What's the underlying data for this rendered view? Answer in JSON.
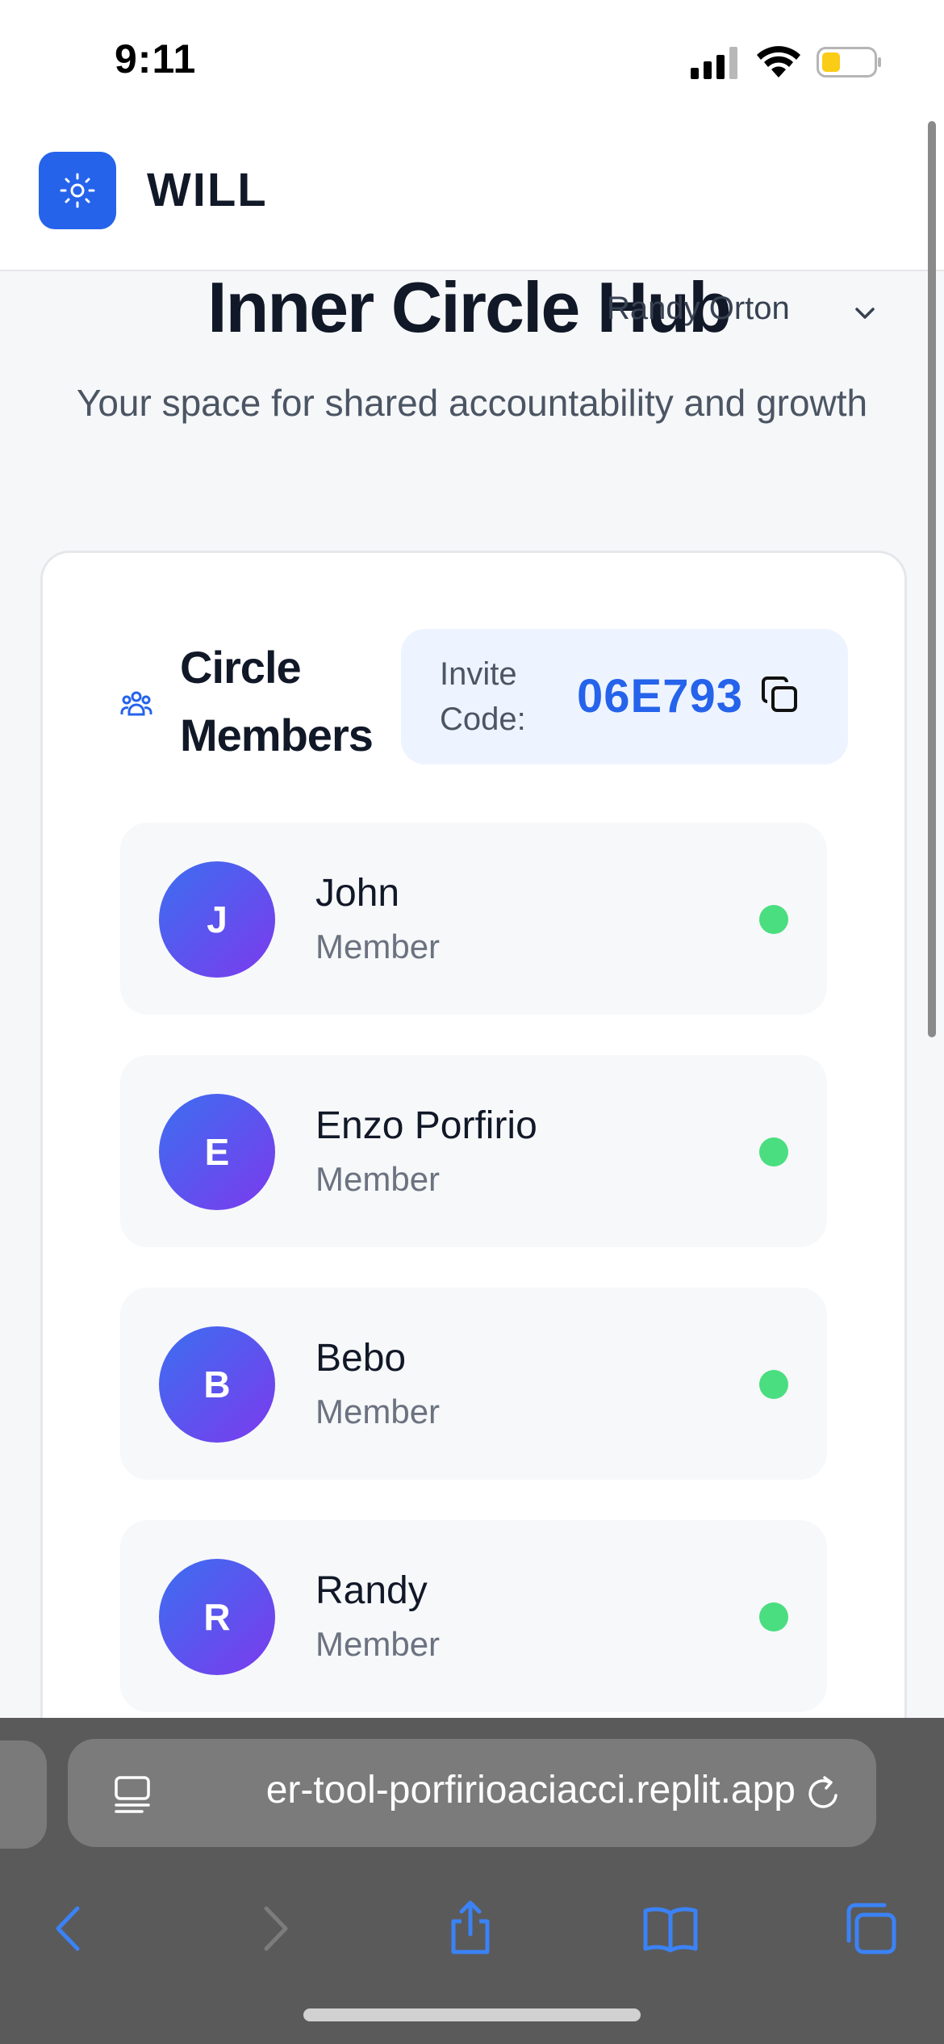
{
  "status_bar": {
    "time": "9:11",
    "icons": [
      "signal-icon",
      "wifi-icon",
      "battery-icon"
    ]
  },
  "header": {
    "app_name": "WILL",
    "logo_icon": "sun-icon",
    "brand_color": "#2563eb"
  },
  "user_menu": {
    "name": "Randy Orton",
    "icon": "chevron-down-icon"
  },
  "page": {
    "title": "Inner Circle Hub",
    "subtitle": "Your space for shared accountability and growth"
  },
  "circle": {
    "title": "Circle Members",
    "icon": "users-icon",
    "invite_label": "Invite Code:",
    "invite_code": "06E793",
    "copy_icon": "copy-icon",
    "members": [
      {
        "initial": "J",
        "name": "John",
        "role": "Member",
        "status": "online"
      },
      {
        "initial": "E",
        "name": "Enzo Porfirio",
        "role": "Member",
        "status": "online"
      },
      {
        "initial": "B",
        "name": "Bebo",
        "role": "Member",
        "status": "online"
      },
      {
        "initial": "R",
        "name": "Randy",
        "role": "Member",
        "status": "online"
      }
    ]
  },
  "browser": {
    "url": "er-tool-porfirioaciacci.replit.app",
    "toolbar": [
      "back-icon",
      "forward-icon",
      "share-icon",
      "bookmarks-icon",
      "tabs-icon"
    ]
  }
}
